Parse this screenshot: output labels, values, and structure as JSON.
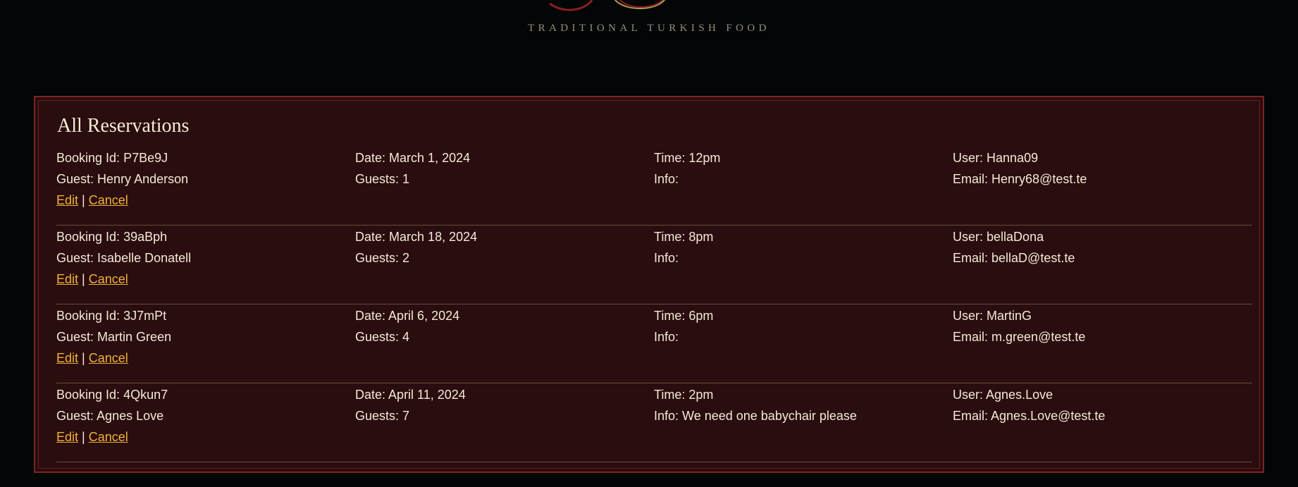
{
  "brand": {
    "tagline": "TRADITIONAL TURKISH FOOD"
  },
  "panel": {
    "title": "All Reservations"
  },
  "labels": {
    "booking_id": "Booking Id:",
    "date": "Date:",
    "time": "Time:",
    "user": "User:",
    "guest": "Guest:",
    "guests": "Guests:",
    "info": "Info:",
    "email": "Email:",
    "edit": "Edit",
    "separator": "|",
    "cancel": "Cancel"
  },
  "reservations": [
    {
      "booking_id": "P7Be9J",
      "date": "March 1, 2024",
      "time": "12pm",
      "user": "Hanna09",
      "guest": "Henry Anderson",
      "guests": "1",
      "info": "",
      "email": "Henry68@test.te"
    },
    {
      "booking_id": "39aBph",
      "date": "March 18, 2024",
      "time": "8pm",
      "user": "bellaDona",
      "guest": "Isabelle Donatell",
      "guests": "2",
      "info": "",
      "email": "bellaD@test.te"
    },
    {
      "booking_id": "3J7mPt",
      "date": "April 6, 2024",
      "time": "6pm",
      "user": "MartinG",
      "guest": "Martin Green",
      "guests": "4",
      "info": "",
      "email": "m.green@test.te"
    },
    {
      "booking_id": "4Qkun7",
      "date": "April 11, 2024",
      "time": "2pm",
      "user": "Agnes.Love",
      "guest": "Agnes Love",
      "guests": "7",
      "info": "We need one babychair please",
      "email": "Agnes.Love@test.te"
    }
  ],
  "colors": {
    "panel_bg": "#2a0d0f",
    "border": "#7a2424",
    "link": "#f0b23a",
    "text": "#f3ead6"
  }
}
